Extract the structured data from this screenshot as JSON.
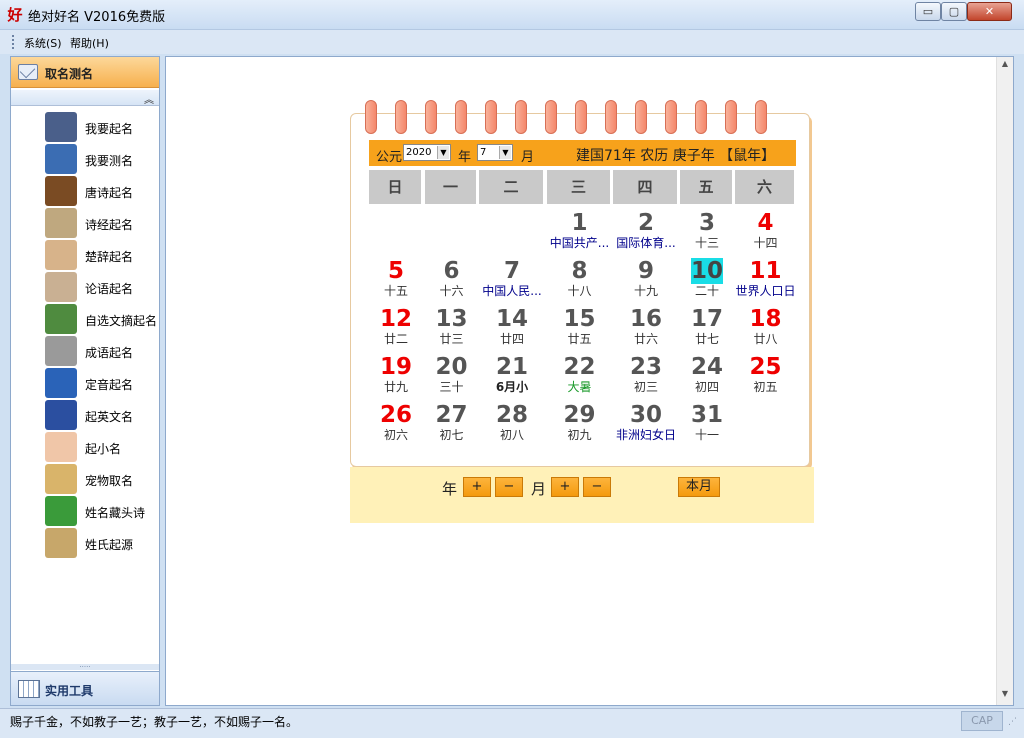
{
  "window": {
    "title": "绝对好名 V2016免费版",
    "minimize_label": "▭",
    "maximize_label": "▢",
    "close_label": "✕"
  },
  "menu": [
    "系统(S)",
    "帮助(H)"
  ],
  "sidebar": {
    "header": "取名测名",
    "collapse_icon": "︽",
    "items": [
      {
        "label": "我要起名",
        "icon": "person-icon",
        "color": "#4a5f8a"
      },
      {
        "label": "我要测名",
        "icon": "magnifier-person-icon",
        "color": "#3b6db3"
      },
      {
        "label": "唐诗起名",
        "icon": "tang-poetry-icon",
        "color": "#7a4b23"
      },
      {
        "label": "诗经起名",
        "icon": "scroll-book-icon",
        "color": "#bfa87f"
      },
      {
        "label": "楚辞起名",
        "icon": "calligraphy-icon",
        "color": "#d7b38a"
      },
      {
        "label": "论语起名",
        "icon": "analects-icon",
        "color": "#c9b093"
      },
      {
        "label": "自选文摘起名",
        "icon": "books-stack-icon",
        "color": "#4f8b3f"
      },
      {
        "label": "成语起名",
        "icon": "idiom-scroll-icon",
        "color": "#9a9a9a"
      },
      {
        "label": "定音起名",
        "icon": "speaker-icon",
        "color": "#2a63b8"
      },
      {
        "label": "起英文名",
        "icon": "uk-flag-icon",
        "color": "#2b4fa0"
      },
      {
        "label": "起小名",
        "icon": "baby-icon",
        "color": "#f0c6a8"
      },
      {
        "label": "宠物取名",
        "icon": "dog-icon",
        "color": "#d9b46a"
      },
      {
        "label": "姓名藏头诗",
        "icon": "poem-tile-icon",
        "color": "#3a9b3a"
      },
      {
        "label": "姓氏起源",
        "icon": "origin-scroll-icon",
        "color": "#c7a76a"
      }
    ],
    "tools_label": "实用工具",
    "grip": "·····"
  },
  "calendar": {
    "era_label": "公元",
    "year_value": "2020",
    "year_label": "年",
    "month_value": "7",
    "month_label": "月",
    "lunar_info": "建国71年  农历 庚子年 【鼠年】",
    "weekdays": [
      "日",
      "一",
      "二",
      "三",
      "四",
      "五",
      "六"
    ],
    "days": [
      {
        "n": "1",
        "sub": "中国共产...",
        "col": 3,
        "row": 0,
        "type": "festival"
      },
      {
        "n": "2",
        "sub": "国际体育...",
        "col": 4,
        "row": 0,
        "type": "festival"
      },
      {
        "n": "3",
        "sub": "十三",
        "col": 5,
        "row": 0,
        "type": ""
      },
      {
        "n": "4",
        "sub": "十四",
        "col": 6,
        "row": 0,
        "type": ""
      },
      {
        "n": "5",
        "sub": "十五",
        "col": 0,
        "row": 1,
        "type": ""
      },
      {
        "n": "6",
        "sub": "十六",
        "col": 1,
        "row": 1,
        "type": ""
      },
      {
        "n": "7",
        "sub": "中国人民...",
        "col": 2,
        "row": 1,
        "type": "festival"
      },
      {
        "n": "8",
        "sub": "十八",
        "col": 3,
        "row": 1,
        "type": ""
      },
      {
        "n": "9",
        "sub": "十九",
        "col": 4,
        "row": 1,
        "type": ""
      },
      {
        "n": "10",
        "sub": "二十",
        "col": 5,
        "row": 1,
        "type": "",
        "today": true
      },
      {
        "n": "11",
        "sub": "世界人口日",
        "col": 6,
        "row": 1,
        "type": "festival"
      },
      {
        "n": "12",
        "sub": "廿二",
        "col": 0,
        "row": 2,
        "type": ""
      },
      {
        "n": "13",
        "sub": "廿三",
        "col": 1,
        "row": 2,
        "type": ""
      },
      {
        "n": "14",
        "sub": "廿四",
        "col": 2,
        "row": 2,
        "type": ""
      },
      {
        "n": "15",
        "sub": "廿五",
        "col": 3,
        "row": 2,
        "type": ""
      },
      {
        "n": "16",
        "sub": "廿六",
        "col": 4,
        "row": 2,
        "type": ""
      },
      {
        "n": "17",
        "sub": "廿七",
        "col": 5,
        "row": 2,
        "type": ""
      },
      {
        "n": "18",
        "sub": "廿八",
        "col": 6,
        "row": 2,
        "type": ""
      },
      {
        "n": "19",
        "sub": "廿九",
        "col": 0,
        "row": 3,
        "type": ""
      },
      {
        "n": "20",
        "sub": "三十",
        "col": 1,
        "row": 3,
        "type": ""
      },
      {
        "n": "21",
        "sub": "6月小",
        "col": 2,
        "row": 3,
        "type": "bold"
      },
      {
        "n": "22",
        "sub": "大暑",
        "col": 3,
        "row": 3,
        "type": "term"
      },
      {
        "n": "23",
        "sub": "初三",
        "col": 4,
        "row": 3,
        "type": ""
      },
      {
        "n": "24",
        "sub": "初四",
        "col": 5,
        "row": 3,
        "type": ""
      },
      {
        "n": "25",
        "sub": "初五",
        "col": 6,
        "row": 3,
        "type": ""
      },
      {
        "n": "26",
        "sub": "初六",
        "col": 0,
        "row": 4,
        "type": ""
      },
      {
        "n": "27",
        "sub": "初七",
        "col": 1,
        "row": 4,
        "type": ""
      },
      {
        "n": "28",
        "sub": "初八",
        "col": 2,
        "row": 4,
        "type": ""
      },
      {
        "n": "29",
        "sub": "初九",
        "col": 3,
        "row": 4,
        "type": ""
      },
      {
        "n": "30",
        "sub": "非洲妇女日",
        "col": 4,
        "row": 4,
        "type": "festival"
      },
      {
        "n": "31",
        "sub": "十一",
        "col": 5,
        "row": 4,
        "type": ""
      }
    ],
    "footer": {
      "year_label": "年",
      "month_label": "月",
      "plus": "+",
      "minus": "−",
      "this_month": "本月"
    },
    "colors": {
      "weekend": "#e00000",
      "today_bg": "#19dde6",
      "header_bg": "#f7a21b",
      "footer_bg": "#fff1b8"
    }
  },
  "status": {
    "text": "赐子千金，不如教子一艺；教子一艺，不如赐子一名。",
    "cap": "CAP"
  }
}
